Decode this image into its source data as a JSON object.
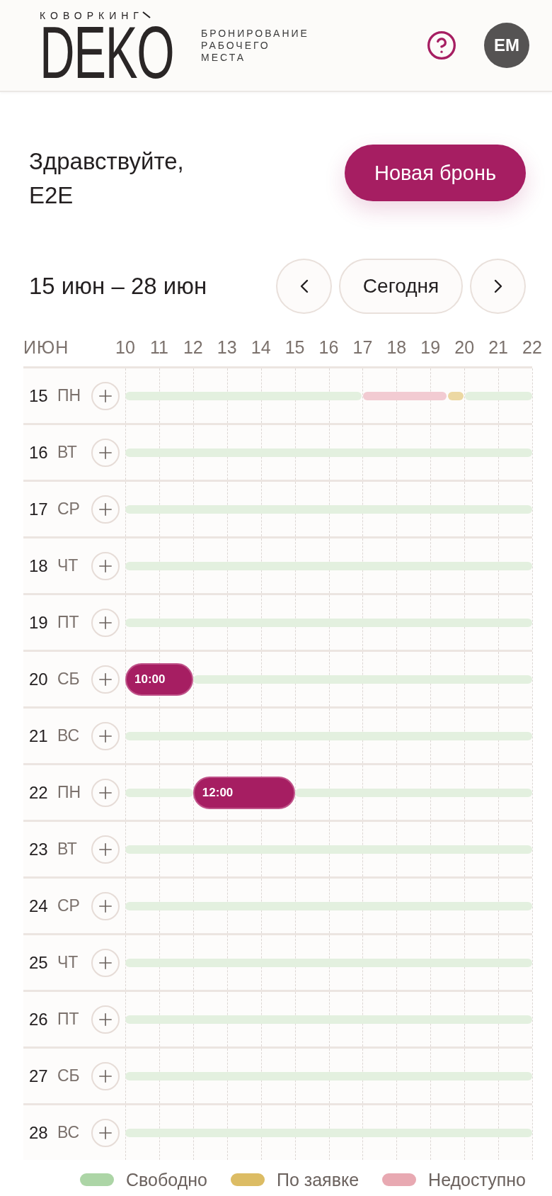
{
  "header": {
    "logo": {
      "overline": "КОВОРКИНГ",
      "wordmark": "DEKO"
    },
    "tagline": "БРОНИРОВАНИЕ\nРАБОЧЕГО\nМЕСТА",
    "avatar": "EM"
  },
  "greeting": "Здравствуйте,\nE2E",
  "new_booking_button": "Новая бронь",
  "range": {
    "label": "15 июн – 28 июн",
    "today_button": "Сегодня"
  },
  "timeline": {
    "month": "ИЮН",
    "hours": [
      "10",
      "11",
      "12",
      "13",
      "14",
      "15",
      "16",
      "17",
      "18",
      "19",
      "20",
      "21",
      "22"
    ],
    "rows": [
      {
        "day": "15",
        "weekday": "ПН",
        "slots": [
          {
            "kind": "free"
          },
          {
            "kind": "free"
          },
          {
            "kind": "free"
          },
          {
            "kind": "free"
          },
          {
            "kind": "free"
          },
          {
            "kind": "free"
          },
          {
            "kind": "free"
          },
          {
            "kind": "free"
          },
          {
            "kind": "free"
          },
          {
            "kind": "free"
          },
          {
            "kind": "free"
          },
          {
            "kind": "free"
          },
          {
            "kind": "free"
          },
          {
            "kind": "free"
          },
          {
            "kind": "unavailable"
          },
          {
            "kind": "unavailable"
          },
          {
            "kind": "unavailable"
          },
          {
            "kind": "unavailable"
          },
          {
            "kind": "unavailable"
          },
          {
            "kind": "on_request"
          },
          {
            "kind": "free"
          },
          {
            "kind": "free"
          },
          {
            "kind": "free"
          },
          {
            "kind": "free"
          }
        ],
        "bookings": []
      },
      {
        "day": "16",
        "weekday": "ВТ",
        "slots": [
          {
            "kind": "free"
          },
          {
            "kind": "free"
          },
          {
            "kind": "free"
          },
          {
            "kind": "free"
          },
          {
            "kind": "free"
          },
          {
            "kind": "free"
          },
          {
            "kind": "free"
          },
          {
            "kind": "free"
          },
          {
            "kind": "free"
          },
          {
            "kind": "free"
          },
          {
            "kind": "free"
          },
          {
            "kind": "free"
          },
          {
            "kind": "free"
          },
          {
            "kind": "free"
          },
          {
            "kind": "free"
          },
          {
            "kind": "free"
          },
          {
            "kind": "free"
          },
          {
            "kind": "free"
          },
          {
            "kind": "free"
          },
          {
            "kind": "free"
          },
          {
            "kind": "free"
          },
          {
            "kind": "free"
          },
          {
            "kind": "free"
          },
          {
            "kind": "free"
          }
        ],
        "bookings": []
      },
      {
        "day": "17",
        "weekday": "СР",
        "slots": [
          {
            "kind": "free"
          },
          {
            "kind": "free"
          },
          {
            "kind": "free"
          },
          {
            "kind": "free"
          },
          {
            "kind": "free"
          },
          {
            "kind": "free"
          },
          {
            "kind": "free"
          },
          {
            "kind": "free"
          },
          {
            "kind": "free"
          },
          {
            "kind": "free"
          },
          {
            "kind": "free"
          },
          {
            "kind": "free"
          },
          {
            "kind": "free"
          },
          {
            "kind": "free"
          },
          {
            "kind": "free"
          },
          {
            "kind": "free"
          },
          {
            "kind": "free"
          },
          {
            "kind": "free"
          },
          {
            "kind": "free"
          },
          {
            "kind": "free"
          },
          {
            "kind": "free"
          },
          {
            "kind": "free"
          },
          {
            "kind": "free"
          },
          {
            "kind": "free"
          }
        ],
        "bookings": []
      },
      {
        "day": "18",
        "weekday": "ЧТ",
        "slots": [
          {
            "kind": "free"
          },
          {
            "kind": "free"
          },
          {
            "kind": "free"
          },
          {
            "kind": "free"
          },
          {
            "kind": "free"
          },
          {
            "kind": "free"
          },
          {
            "kind": "free"
          },
          {
            "kind": "free"
          },
          {
            "kind": "free"
          },
          {
            "kind": "free"
          },
          {
            "kind": "free"
          },
          {
            "kind": "free"
          },
          {
            "kind": "free"
          },
          {
            "kind": "free"
          },
          {
            "kind": "free"
          },
          {
            "kind": "free"
          },
          {
            "kind": "free"
          },
          {
            "kind": "free"
          },
          {
            "kind": "free"
          },
          {
            "kind": "free"
          },
          {
            "kind": "free"
          },
          {
            "kind": "free"
          },
          {
            "kind": "free"
          },
          {
            "kind": "free"
          }
        ],
        "bookings": []
      },
      {
        "day": "19",
        "weekday": "ПТ",
        "slots": [
          {
            "kind": "free"
          },
          {
            "kind": "free"
          },
          {
            "kind": "free"
          },
          {
            "kind": "free"
          },
          {
            "kind": "free"
          },
          {
            "kind": "free"
          },
          {
            "kind": "free"
          },
          {
            "kind": "free"
          },
          {
            "kind": "free"
          },
          {
            "kind": "free"
          },
          {
            "kind": "free"
          },
          {
            "kind": "free"
          },
          {
            "kind": "free"
          },
          {
            "kind": "free"
          },
          {
            "kind": "free"
          },
          {
            "kind": "free"
          },
          {
            "kind": "free"
          },
          {
            "kind": "free"
          },
          {
            "kind": "free"
          },
          {
            "kind": "free"
          },
          {
            "kind": "free"
          },
          {
            "kind": "free"
          },
          {
            "kind": "free"
          },
          {
            "kind": "free"
          }
        ],
        "bookings": []
      },
      {
        "day": "20",
        "weekday": "СБ",
        "slots": [
          {
            "kind": "booked"
          },
          {
            "kind": "booked"
          },
          {
            "kind": "booked"
          },
          {
            "kind": "booked"
          },
          {
            "kind": "free"
          },
          {
            "kind": "free"
          },
          {
            "kind": "free"
          },
          {
            "kind": "free"
          },
          {
            "kind": "free"
          },
          {
            "kind": "free"
          },
          {
            "kind": "free"
          },
          {
            "kind": "free"
          },
          {
            "kind": "free"
          },
          {
            "kind": "free"
          },
          {
            "kind": "free"
          },
          {
            "kind": "free"
          },
          {
            "kind": "free"
          },
          {
            "kind": "free"
          },
          {
            "kind": "free"
          },
          {
            "kind": "free"
          },
          {
            "kind": "free"
          },
          {
            "kind": "free"
          },
          {
            "kind": "free"
          },
          {
            "kind": "free"
          }
        ],
        "bookings": [
          {
            "label": "10:00"
          }
        ]
      },
      {
        "day": "21",
        "weekday": "ВС",
        "slots": [
          {
            "kind": "free"
          },
          {
            "kind": "free"
          },
          {
            "kind": "free"
          },
          {
            "kind": "free"
          },
          {
            "kind": "free"
          },
          {
            "kind": "free"
          },
          {
            "kind": "free"
          },
          {
            "kind": "free"
          },
          {
            "kind": "free"
          },
          {
            "kind": "free"
          },
          {
            "kind": "free"
          },
          {
            "kind": "free"
          },
          {
            "kind": "free"
          },
          {
            "kind": "free"
          },
          {
            "kind": "free"
          },
          {
            "kind": "free"
          },
          {
            "kind": "free"
          },
          {
            "kind": "free"
          },
          {
            "kind": "free"
          },
          {
            "kind": "free"
          },
          {
            "kind": "free"
          },
          {
            "kind": "free"
          },
          {
            "kind": "free"
          },
          {
            "kind": "free"
          }
        ],
        "bookings": []
      },
      {
        "day": "22",
        "weekday": "ПН",
        "slots": [
          {
            "kind": "free"
          },
          {
            "kind": "free"
          },
          {
            "kind": "free"
          },
          {
            "kind": "free"
          },
          {
            "kind": "booked"
          },
          {
            "kind": "booked"
          },
          {
            "kind": "booked"
          },
          {
            "kind": "booked"
          },
          {
            "kind": "booked"
          },
          {
            "kind": "booked"
          },
          {
            "kind": "free"
          },
          {
            "kind": "free"
          },
          {
            "kind": "free"
          },
          {
            "kind": "free"
          },
          {
            "kind": "free"
          },
          {
            "kind": "free"
          },
          {
            "kind": "free"
          },
          {
            "kind": "free"
          },
          {
            "kind": "free"
          },
          {
            "kind": "free"
          },
          {
            "kind": "free"
          },
          {
            "kind": "free"
          },
          {
            "kind": "free"
          },
          {
            "kind": "free"
          }
        ],
        "bookings": [
          {
            "label": "12:00"
          }
        ]
      },
      {
        "day": "23",
        "weekday": "ВТ",
        "slots": [
          {
            "kind": "free"
          },
          {
            "kind": "free"
          },
          {
            "kind": "free"
          },
          {
            "kind": "free"
          },
          {
            "kind": "free"
          },
          {
            "kind": "free"
          },
          {
            "kind": "free"
          },
          {
            "kind": "free"
          },
          {
            "kind": "free"
          },
          {
            "kind": "free"
          },
          {
            "kind": "free"
          },
          {
            "kind": "free"
          },
          {
            "kind": "free"
          },
          {
            "kind": "free"
          },
          {
            "kind": "free"
          },
          {
            "kind": "free"
          },
          {
            "kind": "free"
          },
          {
            "kind": "free"
          },
          {
            "kind": "free"
          },
          {
            "kind": "free"
          },
          {
            "kind": "free"
          },
          {
            "kind": "free"
          },
          {
            "kind": "free"
          },
          {
            "kind": "free"
          }
        ],
        "bookings": []
      },
      {
        "day": "24",
        "weekday": "СР",
        "slots": [
          {
            "kind": "free"
          },
          {
            "kind": "free"
          },
          {
            "kind": "free"
          },
          {
            "kind": "free"
          },
          {
            "kind": "free"
          },
          {
            "kind": "free"
          },
          {
            "kind": "free"
          },
          {
            "kind": "free"
          },
          {
            "kind": "free"
          },
          {
            "kind": "free"
          },
          {
            "kind": "free"
          },
          {
            "kind": "free"
          },
          {
            "kind": "free"
          },
          {
            "kind": "free"
          },
          {
            "kind": "free"
          },
          {
            "kind": "free"
          },
          {
            "kind": "free"
          },
          {
            "kind": "free"
          },
          {
            "kind": "free"
          },
          {
            "kind": "free"
          },
          {
            "kind": "free"
          },
          {
            "kind": "free"
          },
          {
            "kind": "free"
          },
          {
            "kind": "free"
          }
        ],
        "bookings": []
      },
      {
        "day": "25",
        "weekday": "ЧТ",
        "slots": [
          {
            "kind": "free"
          },
          {
            "kind": "free"
          },
          {
            "kind": "free"
          },
          {
            "kind": "free"
          },
          {
            "kind": "free"
          },
          {
            "kind": "free"
          },
          {
            "kind": "free"
          },
          {
            "kind": "free"
          },
          {
            "kind": "free"
          },
          {
            "kind": "free"
          },
          {
            "kind": "free"
          },
          {
            "kind": "free"
          },
          {
            "kind": "free"
          },
          {
            "kind": "free"
          },
          {
            "kind": "free"
          },
          {
            "kind": "free"
          },
          {
            "kind": "free"
          },
          {
            "kind": "free"
          },
          {
            "kind": "free"
          },
          {
            "kind": "free"
          },
          {
            "kind": "free"
          },
          {
            "kind": "free"
          },
          {
            "kind": "free"
          },
          {
            "kind": "free"
          }
        ],
        "bookings": []
      },
      {
        "day": "26",
        "weekday": "ПТ",
        "slots": [
          {
            "kind": "free"
          },
          {
            "kind": "free"
          },
          {
            "kind": "free"
          },
          {
            "kind": "free"
          },
          {
            "kind": "free"
          },
          {
            "kind": "free"
          },
          {
            "kind": "free"
          },
          {
            "kind": "free"
          },
          {
            "kind": "free"
          },
          {
            "kind": "free"
          },
          {
            "kind": "free"
          },
          {
            "kind": "free"
          },
          {
            "kind": "free"
          },
          {
            "kind": "free"
          },
          {
            "kind": "free"
          },
          {
            "kind": "free"
          },
          {
            "kind": "free"
          },
          {
            "kind": "free"
          },
          {
            "kind": "free"
          },
          {
            "kind": "free"
          },
          {
            "kind": "free"
          },
          {
            "kind": "free"
          },
          {
            "kind": "free"
          },
          {
            "kind": "free"
          }
        ],
        "bookings": []
      },
      {
        "day": "27",
        "weekday": "СБ",
        "slots": [
          {
            "kind": "free"
          },
          {
            "kind": "free"
          },
          {
            "kind": "free"
          },
          {
            "kind": "free"
          },
          {
            "kind": "free"
          },
          {
            "kind": "free"
          },
          {
            "kind": "free"
          },
          {
            "kind": "free"
          },
          {
            "kind": "free"
          },
          {
            "kind": "free"
          },
          {
            "kind": "free"
          },
          {
            "kind": "free"
          },
          {
            "kind": "free"
          },
          {
            "kind": "free"
          },
          {
            "kind": "free"
          },
          {
            "kind": "free"
          },
          {
            "kind": "free"
          },
          {
            "kind": "free"
          },
          {
            "kind": "free"
          },
          {
            "kind": "free"
          },
          {
            "kind": "free"
          },
          {
            "kind": "free"
          },
          {
            "kind": "free"
          },
          {
            "kind": "free"
          }
        ],
        "bookings": []
      },
      {
        "day": "28",
        "weekday": "ВС",
        "slots": [
          {
            "kind": "free"
          },
          {
            "kind": "free"
          },
          {
            "kind": "free"
          },
          {
            "kind": "free"
          },
          {
            "kind": "free"
          },
          {
            "kind": "free"
          },
          {
            "kind": "free"
          },
          {
            "kind": "free"
          },
          {
            "kind": "free"
          },
          {
            "kind": "free"
          },
          {
            "kind": "free"
          },
          {
            "kind": "free"
          },
          {
            "kind": "free"
          },
          {
            "kind": "free"
          },
          {
            "kind": "free"
          },
          {
            "kind": "free"
          },
          {
            "kind": "free"
          },
          {
            "kind": "free"
          },
          {
            "kind": "free"
          },
          {
            "kind": "free"
          },
          {
            "kind": "free"
          },
          {
            "kind": "free"
          },
          {
            "kind": "free"
          },
          {
            "kind": "free"
          }
        ],
        "bookings": []
      }
    ]
  },
  "legend": [
    {
      "label": "Свободно",
      "color": "#acd5a6"
    },
    {
      "label": "По заявке",
      "color": "#dcbc64"
    },
    {
      "label": "Недоступно",
      "color": "#e8a9b2"
    }
  ]
}
